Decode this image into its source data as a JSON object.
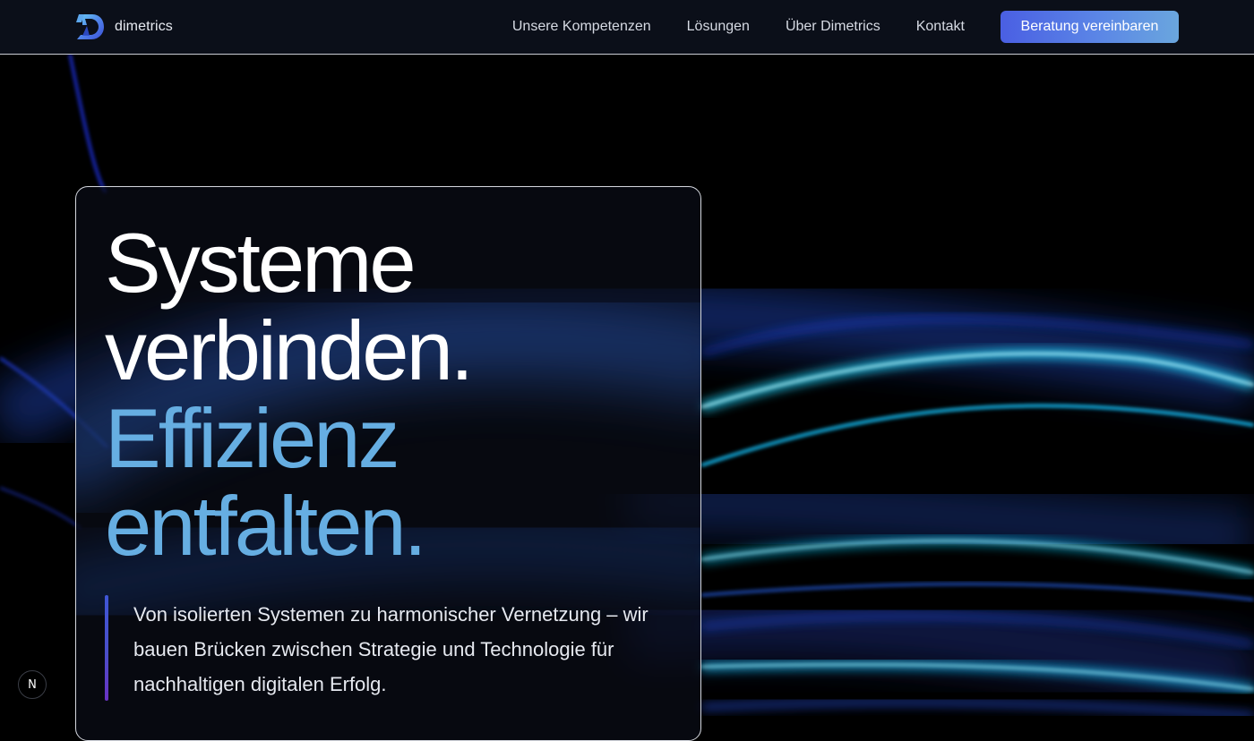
{
  "header": {
    "brand": {
      "name": "dimetrics",
      "logo_icon": "dimetrics-d-logo-icon"
    },
    "nav": [
      {
        "label": "Unsere Kompetenzen"
      },
      {
        "label": "Lösungen"
      },
      {
        "label": "Über Dimetrics"
      },
      {
        "label": "Kontakt"
      }
    ],
    "cta_label": "Beratung vereinbaren"
  },
  "hero": {
    "headline_line_1": "Systeme",
    "headline_line_2": "verbinden.",
    "headline_line_3": "Effizienz",
    "headline_line_4": "entfalten.",
    "tagline": "Von isolierten Systemen zu harmonischer Vernetzung – wir bauen Brücken zwischen Strategie und Technologie für nachhaltigen digitalen Erfolg."
  },
  "badge": {
    "label": "N",
    "icon": "nextjs-n-icon"
  },
  "colors": {
    "header_bg": "#0b0f19",
    "accent_blue_text": "#66aee2",
    "cta_gradient_start": "#4a5fe3",
    "cta_gradient_end": "#6aa6de",
    "wave_cyan": "#18c8ff",
    "wave_blue": "#2a55ff"
  }
}
